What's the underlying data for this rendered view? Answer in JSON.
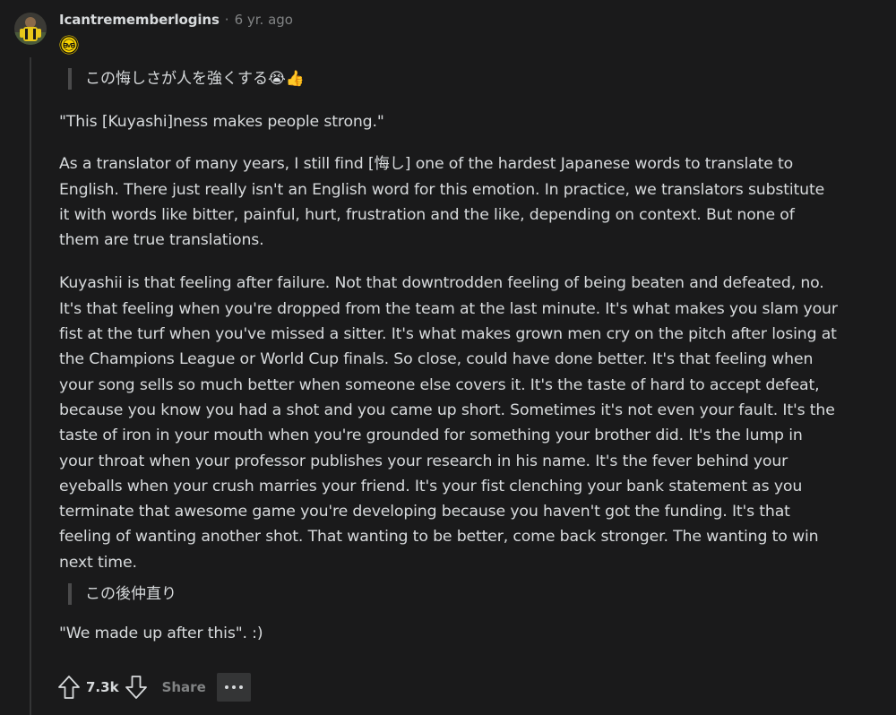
{
  "comment": {
    "username": "Icantrememberlogins",
    "separator": "·",
    "time": "6 yr. ago",
    "flair_icon": "bvb-crest-icon",
    "quote_1": "この悔しさが人を強くする😭👍",
    "paragraph_1": "\"This [Kuyashi]ness makes people strong.\"",
    "paragraph_2": "As a translator of many years, I still find [悔し] one of the hardest Japanese words to translate to English. There just really isn't an English word for this emotion. In practice, we translators substitute it with words like bitter, painful, hurt, frustration and the like, depending on context. But none of them are true translations.",
    "paragraph_3": "Kuyashii is that feeling after failure. Not that downtrodden feeling of being beaten and defeated, no. It's that feeling when you're dropped from the team at the last minute. It's what makes you slam your fist at the turf when you've missed a sitter. It's what makes grown men cry on the pitch after losing at the Champions League or World Cup finals. So close, could have done better. It's that feeling when your song sells so much better when someone else covers it. It's the taste of hard to accept defeat, because you know you had a shot and you came up short. Sometimes it's not even your fault. It's the taste of iron in your mouth when you're grounded for something your brother did. It's the lump in your throat when your professor publishes your research in his name. It's the fever behind your eyeballs when your crush marries your friend. It's your fist clenching your bank statement as you terminate that awesome game you're developing because you haven't got the funding. It's that feeling of wanting another shot. That wanting to be better, come back stronger. The wanting to win next time.",
    "quote_2": "この後仲直り",
    "paragraph_4": "\"We made up after this\". :)"
  },
  "actions": {
    "upvote_icon": "arrow-up-icon",
    "score": "7.3k",
    "downvote_icon": "arrow-down-icon",
    "share_label": "Share",
    "more_icon": "ellipsis-icon"
  },
  "colors": {
    "background": "#1a1a1b",
    "text": "#d7dadc",
    "muted": "#818384",
    "quote_bar": "#4a4a4b",
    "more_button_bg": "#343536"
  }
}
